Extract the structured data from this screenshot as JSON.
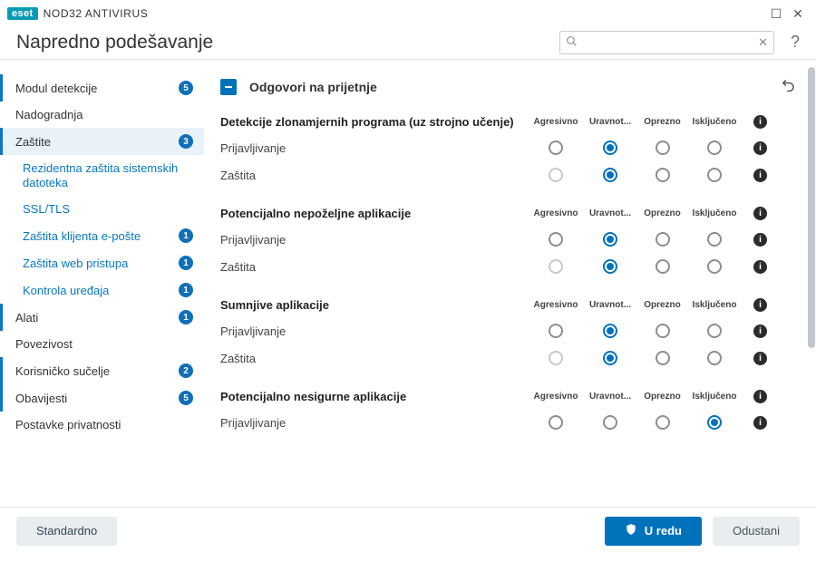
{
  "window": {
    "brand": "eset",
    "product": "NOD32 ANTIVIRUS",
    "maximize": "☐",
    "close": "✕"
  },
  "topbar": {
    "title": "Napredno podešavanje",
    "search_placeholder": "",
    "help": "?"
  },
  "sidebar": [
    {
      "id": "detection",
      "label": "Modul detekcije",
      "badge": "5",
      "type": "section",
      "accent": true
    },
    {
      "id": "upgrade",
      "label": "Nadogradnja",
      "type": "section"
    },
    {
      "id": "protections",
      "label": "Zaštite",
      "badge": "3",
      "type": "section",
      "selected": true,
      "accent": true
    },
    {
      "id": "sub-rts",
      "label": "Rezidentna zaštita sistemskih datoteka",
      "type": "sub"
    },
    {
      "id": "sub-ssl",
      "label": "SSL/TLS",
      "type": "sub"
    },
    {
      "id": "sub-email",
      "label": "Zaštita klijenta e-pošte",
      "badge": "1",
      "type": "sub"
    },
    {
      "id": "sub-web",
      "label": "Zaštita web pristupa",
      "badge": "1",
      "type": "sub"
    },
    {
      "id": "sub-devctl",
      "label": "Kontrola uređaja",
      "badge": "1",
      "type": "sub"
    },
    {
      "id": "tools",
      "label": "Alati",
      "badge": "1",
      "type": "section",
      "accent": true
    },
    {
      "id": "connectivity",
      "label": "Povezivost",
      "type": "section"
    },
    {
      "id": "ui",
      "label": "Korisničko sučelje",
      "badge": "2",
      "type": "section",
      "accent": true
    },
    {
      "id": "notif",
      "label": "Obavijesti",
      "badge": "5",
      "type": "section",
      "accent": true
    },
    {
      "id": "privacy",
      "label": "Postavke privatnosti",
      "type": "section"
    }
  ],
  "panel": {
    "title": "Odgovori na prijetnje",
    "columns": [
      "Agresivno",
      "Uravnot...",
      "Oprezno",
      "Isključeno"
    ],
    "categories": [
      {
        "name": "Detekcije zlonamjernih programa (uz strojno učenje)",
        "rows": [
          {
            "name": "Prijavljivanje",
            "selected": 1,
            "disabled": []
          },
          {
            "name": "Zaštita",
            "selected": 1,
            "disabled": [
              0
            ]
          }
        ]
      },
      {
        "name": "Potencijalno nepoželjne aplikacije",
        "rows": [
          {
            "name": "Prijavljivanje",
            "selected": 1,
            "disabled": []
          },
          {
            "name": "Zaštita",
            "selected": 1,
            "disabled": [
              0
            ]
          }
        ]
      },
      {
        "name": "Sumnjive aplikacije",
        "rows": [
          {
            "name": "Prijavljivanje",
            "selected": 1,
            "disabled": []
          },
          {
            "name": "Zaštita",
            "selected": 1,
            "disabled": [
              0
            ]
          }
        ]
      },
      {
        "name": "Potencijalno nesigurne aplikacije",
        "rows": [
          {
            "name": "Prijavljivanje",
            "selected": 3,
            "disabled": []
          }
        ]
      }
    ]
  },
  "footer": {
    "default": "Standardno",
    "ok": "U redu",
    "cancel": "Odustani"
  }
}
